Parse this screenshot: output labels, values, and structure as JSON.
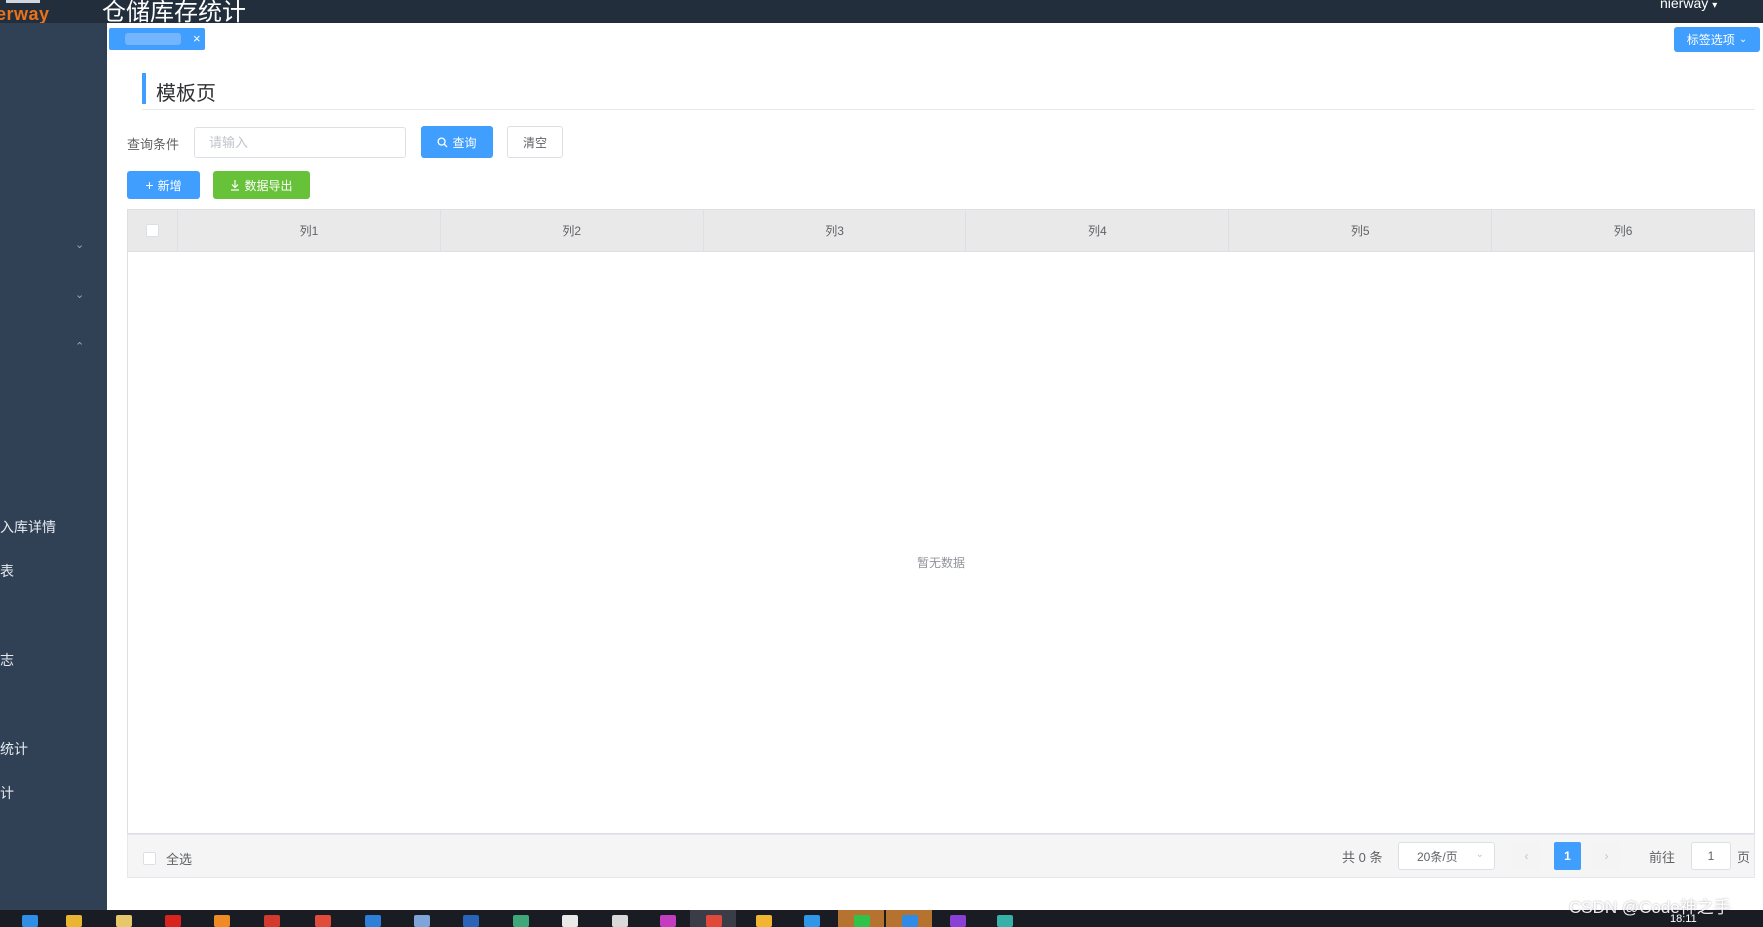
{
  "header": {
    "logo_text": "erway",
    "app_title": "仓储库存统计",
    "user_name": "nierway"
  },
  "sidebar": {
    "items": [
      {
        "label": "入库详情"
      },
      {
        "label": "表"
      },
      {
        "label": "志"
      },
      {
        "label": "统计"
      },
      {
        "label": "计"
      }
    ]
  },
  "tags": {
    "close_symbol": "×",
    "options_label": "标签选项"
  },
  "page": {
    "title": "模板页"
  },
  "filter": {
    "label": "查询条件",
    "placeholder": "请输入",
    "query_label": "查询",
    "clear_label": "清空"
  },
  "actions": {
    "add_label": "新增",
    "export_label": "数据导出"
  },
  "table": {
    "columns": [
      "列1",
      "列2",
      "列3",
      "列4",
      "列5",
      "列6"
    ],
    "rows": [],
    "empty_text": "暂无数据"
  },
  "footer": {
    "select_all_label": "全选",
    "total_text": "共 0 条",
    "page_size": "20条/页",
    "current_page": "1",
    "goto_label": "前往",
    "goto_value": "1",
    "goto_suffix": "页"
  },
  "taskbar": {
    "clock": "18:11"
  },
  "watermark": "CSDN @Code神之手",
  "colors": {
    "primary": "#409eff",
    "success": "#67c23a",
    "sidebar_bg": "#304156",
    "header_bg": "#222e3c",
    "logo": "#e8731c"
  }
}
